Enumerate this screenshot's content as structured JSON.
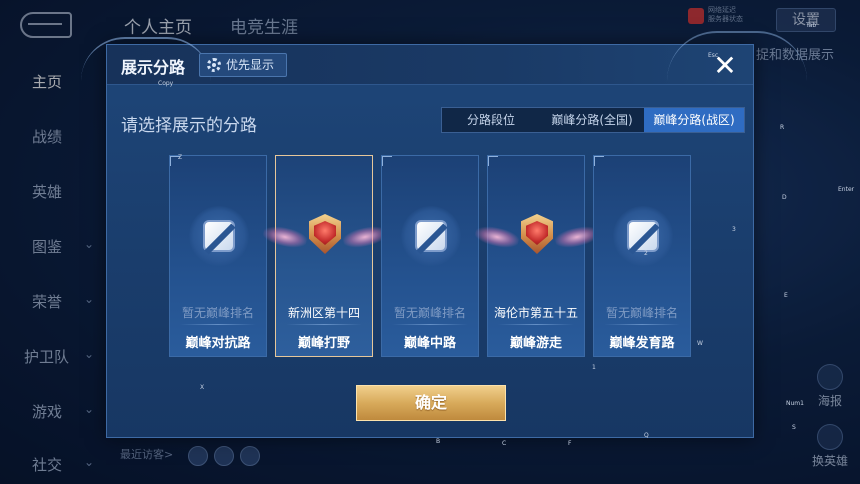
{
  "app": {
    "top_tabs": [
      {
        "label": "个人主页",
        "active": true
      },
      {
        "label": "电竞生涯",
        "active": false
      }
    ],
    "settings_label": "设置",
    "right_tag": "捉和数据展示",
    "net_status": [
      "网络延迟",
      "服务器状态"
    ],
    "side_nav": [
      {
        "label": "主页",
        "active": true,
        "expand": false
      },
      {
        "label": "战绩",
        "active": false,
        "expand": false
      },
      {
        "label": "英雄",
        "active": false,
        "expand": false
      },
      {
        "label": "图鉴",
        "active": false,
        "expand": true
      },
      {
        "label": "荣誉",
        "active": false,
        "expand": true
      },
      {
        "label": "护卫队",
        "active": false,
        "expand": true
      },
      {
        "label": "游戏",
        "active": false,
        "expand": true
      },
      {
        "label": "社交",
        "active": false,
        "expand": true
      }
    ],
    "visitors_label": "最近访客>",
    "right_buttons": [
      {
        "label": "海报",
        "icon": "poster-icon"
      },
      {
        "label": "换英雄",
        "icon": "swap-hero-icon"
      }
    ]
  },
  "modal": {
    "title": "展示分路",
    "priority_button": "优先显示",
    "prompt": "请选择展示的分路",
    "segments": [
      {
        "label": "分路段位",
        "active": false
      },
      {
        "label": "巅峰分路(全国)",
        "active": false
      },
      {
        "label": "巅峰分路(战区)",
        "active": true
      }
    ],
    "cards": [
      {
        "rank": "暂无巅峰排名",
        "lane": "巅峰对抗路",
        "has_rank": false,
        "selected": false,
        "icon": "clash-lane-icon"
      },
      {
        "rank": "新洲区第十四",
        "lane": "巅峰打野",
        "has_rank": true,
        "selected": true,
        "icon": "jungle-rank-badge-icon"
      },
      {
        "rank": "暂无巅峰排名",
        "lane": "巅峰中路",
        "has_rank": false,
        "selected": false,
        "icon": "mid-lane-icon"
      },
      {
        "rank": "海伦市第五十五",
        "lane": "巅峰游走",
        "has_rank": true,
        "selected": false,
        "icon": "roam-rank-badge-icon"
      },
      {
        "rank": "暂无巅峰排名",
        "lane": "巅峰发育路",
        "has_rank": false,
        "selected": false,
        "icon": "farm-lane-icon"
      }
    ],
    "confirm_label": "确定",
    "colors": {
      "accent_gold": "#d8aa5b",
      "selected_segment": "#2f6cc2",
      "selected_card_border": "#e6c79a"
    }
  },
  "key_hints": [
    "Copy",
    "Esc",
    "Tab",
    "R",
    "D",
    "Enter",
    "3",
    "E",
    "Z",
    "2",
    "W",
    "1",
    "X",
    "B",
    "C",
    "F",
    "Q",
    "Num1",
    "S"
  ]
}
